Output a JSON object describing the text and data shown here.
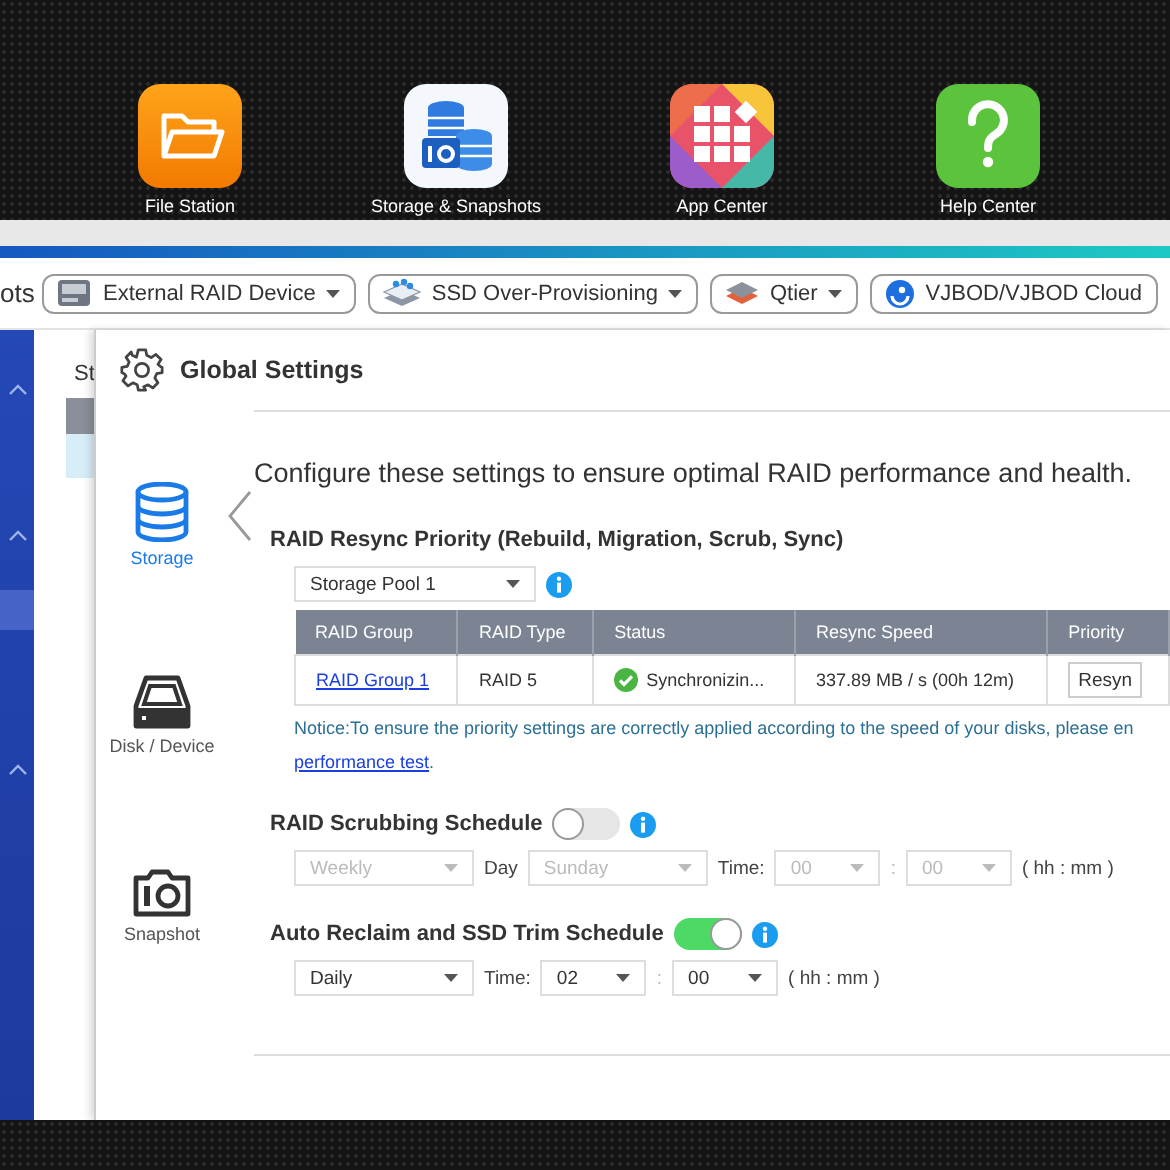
{
  "desktop_apps": [
    {
      "label": "File Station",
      "kind": "folder"
    },
    {
      "label": "Storage & Snapshots",
      "kind": "storage"
    },
    {
      "label": "App Center",
      "kind": "apps"
    },
    {
      "label": "Help Center",
      "kind": "help"
    }
  ],
  "window": {
    "title_fragment": "ots"
  },
  "toolbar_buttons": [
    {
      "label": "External RAID Device",
      "kind": "raid",
      "caret": true
    },
    {
      "label": "SSD Over-Provisioning",
      "kind": "ssd",
      "caret": true
    },
    {
      "label": "Qtier",
      "kind": "tier",
      "caret": true
    },
    {
      "label": "VJBOD/VJBOD Cloud",
      "kind": "cloud",
      "caret": false
    }
  ],
  "sidebar": {
    "items": [
      {
        "kind": "group",
        "expanded": true
      },
      {
        "kind": "group",
        "expanded": true
      },
      {
        "kind": "entry",
        "selected": true
      },
      {
        "kind": "group",
        "expanded": true
      }
    ]
  },
  "background_panel": {
    "title": "St"
  },
  "dialog": {
    "title": "Global Settings",
    "nav": [
      {
        "label": "Storage",
        "kind": "storage",
        "selected": true
      },
      {
        "label": "Disk / Device",
        "kind": "disk",
        "selected": false
      },
      {
        "label": "Snapshot",
        "kind": "snapshot",
        "selected": false
      }
    ],
    "intro": "Configure these settings to ensure optimal RAID performance and health.",
    "resync": {
      "title": "RAID Resync Priority (Rebuild, Migration, Scrub, Sync)",
      "pool": "Storage Pool 1",
      "columns": [
        "RAID Group",
        "RAID Type",
        "Status",
        "Resync Speed",
        "Priority"
      ],
      "rows": [
        {
          "raid_group": "RAID Group 1",
          "raid_type": "RAID 5",
          "status": "Synchronizin...",
          "status_ok": true,
          "resync_speed": "337.89 MB / s (00h 12m)",
          "priority": "Resyn"
        }
      ],
      "notice": "Notice:To ensure the priority settings are correctly applied according to the speed of your disks, please en",
      "notice_link": "performance test",
      "notice_end": "."
    },
    "scrub": {
      "title": "RAID Scrubbing Schedule",
      "enabled": false,
      "frequency": "Weekly",
      "day_label": "Day",
      "day": "Sunday",
      "time_label": "Time:",
      "hour": "00",
      "separator": ":",
      "minute": "00",
      "format": "( hh : mm )"
    },
    "trim": {
      "title": "Auto Reclaim and SSD Trim Schedule",
      "enabled": true,
      "frequency": "Daily",
      "time_label": "Time:",
      "hour": "02",
      "separator": ":",
      "minute": "00",
      "format": "( hh : mm )"
    }
  }
}
